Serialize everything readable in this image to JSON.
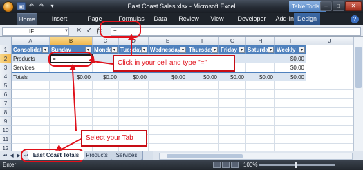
{
  "window": {
    "title": "East Coast Sales.xlsx - Microsoft Excel",
    "context_tab_group": "Table Tools",
    "controls": [
      "–",
      "□",
      "✕"
    ]
  },
  "quick_access": [
    "▣",
    "↶",
    "↷",
    "▾"
  ],
  "ribbon_tabs": [
    "Home",
    "Insert",
    "Page Layout",
    "Formulas",
    "Data",
    "Review",
    "View",
    "Developer",
    "Add-Ins",
    "Design"
  ],
  "ribbon_help": "?",
  "formula_bar": {
    "name_box": "IF",
    "cancel": "✕",
    "enter": "✓",
    "fx": "fx",
    "value": "="
  },
  "columns": [
    "A",
    "B",
    "C",
    "D",
    "E",
    "F",
    "G",
    "H",
    "I",
    "J"
  ],
  "rows": [
    "1",
    "2",
    "3",
    "4",
    "5",
    "6",
    "7",
    "8",
    "9",
    "10",
    "11",
    "12"
  ],
  "table": {
    "headers": [
      "Consolidated",
      "Sunday",
      "Monday",
      "Tuesday",
      "Wednesday",
      "Thursday",
      "Friday",
      "Saturday",
      "Weekly"
    ],
    "rows": [
      {
        "label": "Products",
        "values": [
          "=",
          "",
          "",
          "",
          "",
          "",
          "",
          "$0.00"
        ]
      },
      {
        "label": "Services",
        "values": [
          "",
          "",
          "",
          "",
          "",
          "",
          "",
          "$0.00"
        ]
      },
      {
        "label": "Totals",
        "values": [
          "$0.00",
          "$0.00",
          "$0.00",
          "$0.00",
          "$0.00",
          "$0.00",
          "$0.00",
          "$0.00"
        ]
      }
    ]
  },
  "annotations": {
    "cell_tip": "Click in your cell and type \"=\"",
    "tab_tip": "Select your Tab",
    "color": "#e0101a"
  },
  "sheet_tabs": {
    "nav": [
      "⏮",
      "◀",
      "▶",
      "⏭"
    ],
    "tabs": [
      "East Coast Totals",
      "Products",
      "Services"
    ]
  },
  "status": {
    "ready": "Enter",
    "zoom": "100%"
  }
}
